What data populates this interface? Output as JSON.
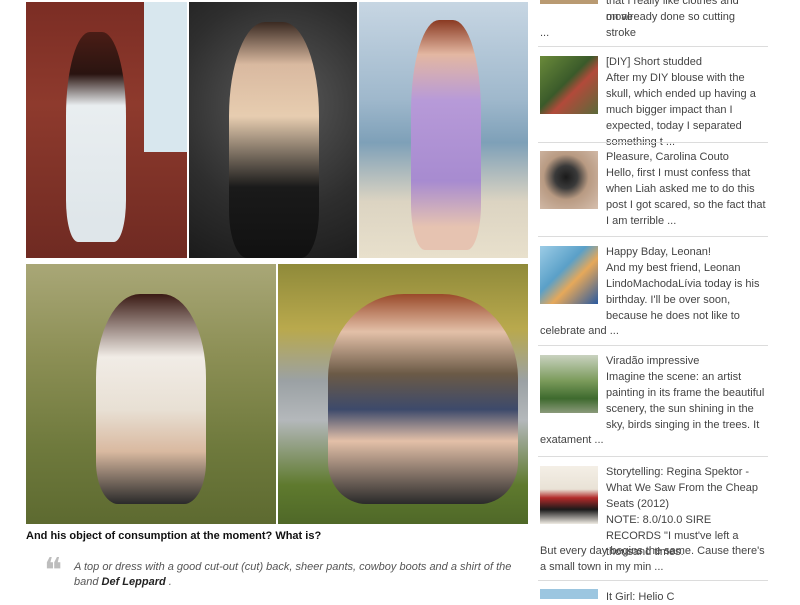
{
  "main": {
    "question": "And his object of consumption at the moment? What is?",
    "quote_mark": "❝",
    "quote_text_before": "A top or dress with a good cut-out (cut) back, sheer pants, cowboy boots and a shirt of the band ",
    "quote_text_bold": "Def Leppard",
    "quote_text_after": " ."
  },
  "sidebar": {
    "top_fragment_line1": "that I really like clothes and move",
    "top_fragment_line2": "on already done so cutting stroke",
    "top_fragment_line3": "...",
    "posts": [
      {
        "title": "[DIY] Short studded",
        "excerpt": "After my DIY blouse with the skull, which ended up having a much bigger impact than I expected, today I separated something t ..."
      },
      {
        "title": "Pleasure, Carolina Couto",
        "excerpt": "Hello, first I must confess that when Liah asked me to do this post I got scared, so the fact that I am terrible ..."
      },
      {
        "title": "Happy Bday, Leonan!",
        "excerpt": "  And my best friend, Leonan LindoMachodaLívia today is his birthday. I'll be over soon, because he does not like to",
        "excerpt_tail": "celebrate and ..."
      },
      {
        "title": "Viradão impressive",
        "excerpt": "Imagine the scene: an artist painting in its frame the beautiful scenery, the sun shining in the sky, birds singing in the trees. It",
        "excerpt_tail": "exatament ..."
      },
      {
        "title": "Storytelling: Regina Spektor - What We Saw From the Cheap Seats (2012)",
        "excerpt": "NOTE: 8.0/10.0 SIRE RECORDS \"I must've left a thousand times.",
        "excerpt_tail": "But every day begins the same. Cause there's a small town in my min ..."
      },
      {
        "title": "It Girl: Helio C"
      }
    ]
  }
}
